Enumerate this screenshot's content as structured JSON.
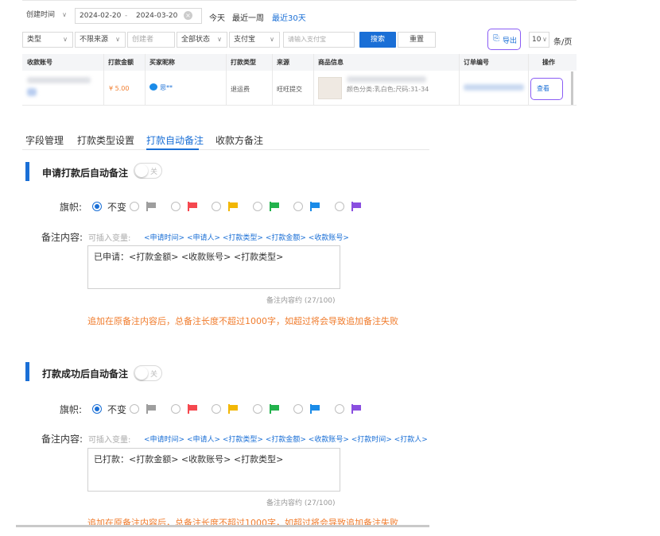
{
  "filters": {
    "time_type": "创建时间",
    "date_start": "2024-02-20",
    "date_sep": "-",
    "date_end": "2024-03-20",
    "quick": [
      "今天",
      "最近一周",
      "最近30天"
    ],
    "type": "类型",
    "source": "不限来源",
    "creator_placeholder": "创建者",
    "status": "全部状态",
    "pay_method": "支付宝",
    "alipay_placeholder": "请输入支付宝",
    "search_label": "搜索",
    "reset_label": "重置",
    "export_label": "导出",
    "page_size": "10",
    "per_page_suffix": "条/页"
  },
  "table": {
    "columns": [
      "收款账号",
      "打款金额",
      "买家昵称",
      "打款类型",
      "来源",
      "商品信息",
      "订单编号",
      "操作"
    ],
    "row": {
      "amount": "¥ 5.00",
      "buyer": "思**",
      "pay_type": "退运费",
      "source": "旺旺提交",
      "product_spec": "颜色分类:乳白色;尺码:31-34",
      "action": "查看"
    }
  },
  "settings": {
    "tabs": [
      "字段管理",
      "打款类型设置",
      "打款自动备注",
      "收款方备注"
    ],
    "active_tab": 2,
    "section1": {
      "title": "申请打款后自动备注",
      "toggle": "关",
      "flag_label": "旗帜:",
      "no_change": "不变",
      "note_label": "备注内容:",
      "var_hint": "可插入变量:",
      "vars": "<申请时间> <申请人> <打款类型> <打款金额> <收款账号>",
      "text": "已申请：<打款金额> <收款账号> <打款类型>",
      "count": "备注内容约 (27/100)",
      "warning": "追加在原备注内容后，总备注长度不超过1000字，如超过将会导致追加备注失败"
    },
    "section2": {
      "title": "打款成功后自动备注",
      "toggle": "关",
      "flag_label": "旗帜:",
      "no_change": "不变",
      "note_label": "备注内容:",
      "var_hint": "可插入变量:",
      "vars": "<申请时间> <申请人> <打款类型> <打款金额> <收款账号> <打款时间> <打款人>",
      "text": "已打款：<打款金额> <收款账号> <打款类型>",
      "count": "备注内容约 (27/100)",
      "warning": "追加在原备注内容后，总备注长度不超过1000字，如超过将会导致追加备注失败"
    },
    "flag_colors": [
      "#9e9e9e",
      "#f5484f",
      "#f2b705",
      "#22b24c",
      "#1a8be8",
      "#8a4fe0"
    ],
    "accent": "#1a6fd6",
    "warning_color": "#f07c2d"
  }
}
